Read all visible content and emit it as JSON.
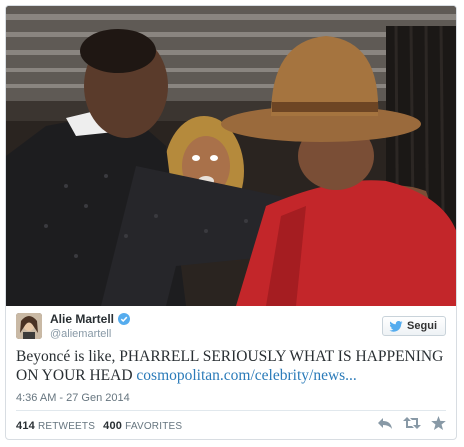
{
  "author": {
    "display_name": "Alie Martell",
    "handle": "@aliemartell"
  },
  "follow_button": {
    "label": "Segui"
  },
  "tweet": {
    "text": "Beyoncé is like, PHARRELL SERIOUSLY WHAT IS HAPPENING ON YOUR HEAD ",
    "link": "cosmopolitan.com/celebrity/news..."
  },
  "timestamp": "4:36 AM - 27 Gen 2014",
  "stats": {
    "retweets_count": "414",
    "retweets_label": "RETWEETS",
    "favorites_count": "400",
    "favorites_label": "FAVORITES"
  },
  "icons": {
    "verified": "verified-badge-icon",
    "follow": "twitter-bird-icon",
    "reply": "reply-icon",
    "retweet": "retweet-icon",
    "favorite": "star-icon"
  },
  "colors": {
    "link": "#2b7bb9",
    "verified": "#55acee",
    "twitter_blue": "#55acee",
    "text": "#292f33",
    "muted": "#8899a6"
  }
}
